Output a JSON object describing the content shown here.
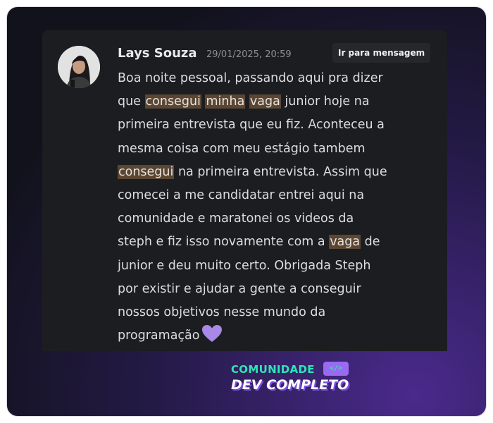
{
  "post": {
    "author": "Lays Souza",
    "timestamp": "29/01/2025, 20:59",
    "jump_button_label": "Ir para mensagem",
    "message_lines": [
      [
        "Boa noite pessoal, passando aqui pra dizer"
      ],
      [
        "que ",
        "consegui",
        " ",
        "minha",
        " ",
        "vaga",
        " junior hoje na"
      ],
      [
        "primeira entrevista que eu fiz. Aconteceu a"
      ],
      [
        "mesma coisa com meu estágio tambem"
      ],
      [
        "consegui",
        " na primeira entrevista. Assim que"
      ],
      [
        "comecei a me candidatar entrei aqui na"
      ],
      [
        "comunidade e maratonei os videos da"
      ],
      [
        "steph e fiz isso novamente com a ",
        "vaga",
        " de"
      ],
      [
        "junior e deu muito certo. Obrigada Steph"
      ],
      [
        "por existir e ajudar a gente a conseguir"
      ],
      [
        "nossos objetivos nesse mundo da"
      ],
      [
        "programação"
      ]
    ],
    "highlighted_words": [
      "consegui",
      "minha",
      "vaga"
    ],
    "emoji": "purple-heart",
    "avatar_icon": "user-photo"
  },
  "brand": {
    "line1": "COMUNIDADE",
    "badge": "</>",
    "line2": "DEV COMPLETO"
  },
  "colors": {
    "card_background": "#1c1d20",
    "highlight": "#5b4634",
    "heart": "#a988e8",
    "brand_green": "#2ee6b8",
    "brand_purple": "#7c4ee0"
  }
}
